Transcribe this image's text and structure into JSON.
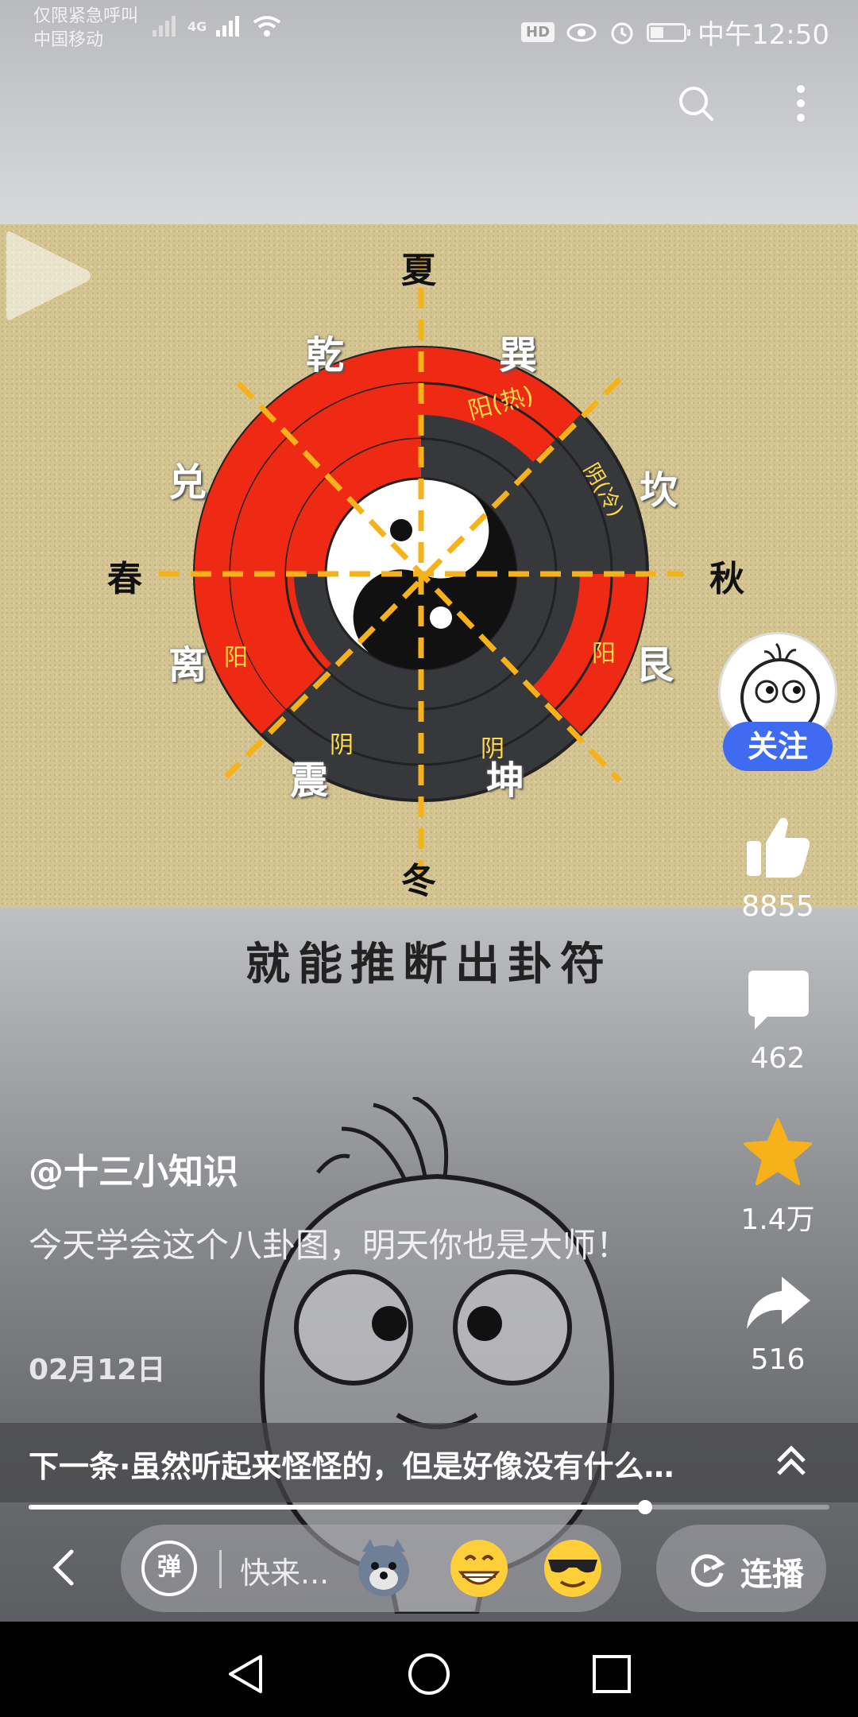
{
  "status_bar": {
    "line1": "仅限紧急呼叫",
    "carrier": "中国移动",
    "network": "4G",
    "hd": "HD",
    "time": "中午12:50"
  },
  "video": {
    "center_texts": {
      "summer": "夏",
      "winter": "冬",
      "spring": "春",
      "autumn": "秋",
      "qian": "乾",
      "xun": "巽",
      "dui": "兑",
      "kan": "坎",
      "li": "离",
      "gen": "艮",
      "zhen": "震",
      "kun": "坤",
      "ring_yang_hot": "阳(热)",
      "ring_yin_cold": "阴(冷)",
      "ring_yang_left": "阳",
      "ring_yang_right": "阳",
      "ring_yin_left": "阴",
      "ring_yin_right": "阴"
    },
    "subtitle": "就能推断出卦符"
  },
  "rail": {
    "follow_label": "关注",
    "likes": "8855",
    "comments": "462",
    "favorites": "1.4万",
    "shares": "516"
  },
  "post": {
    "author": "@十三小知识",
    "description": "今天学会这个八卦图，明天你也是大师！",
    "date": "02月12日"
  },
  "next": {
    "text": "下一条·虽然听起来怪怪的，但是好像没有什么…"
  },
  "progress": {
    "fraction": 0.77
  },
  "bottom": {
    "danmu_label": "弹",
    "comment_placeholder": "快来...",
    "lianbo_label": "连播"
  },
  "colors": {
    "follow_blue": "#3f6bf0",
    "star_yellow": "#f7b21a"
  }
}
